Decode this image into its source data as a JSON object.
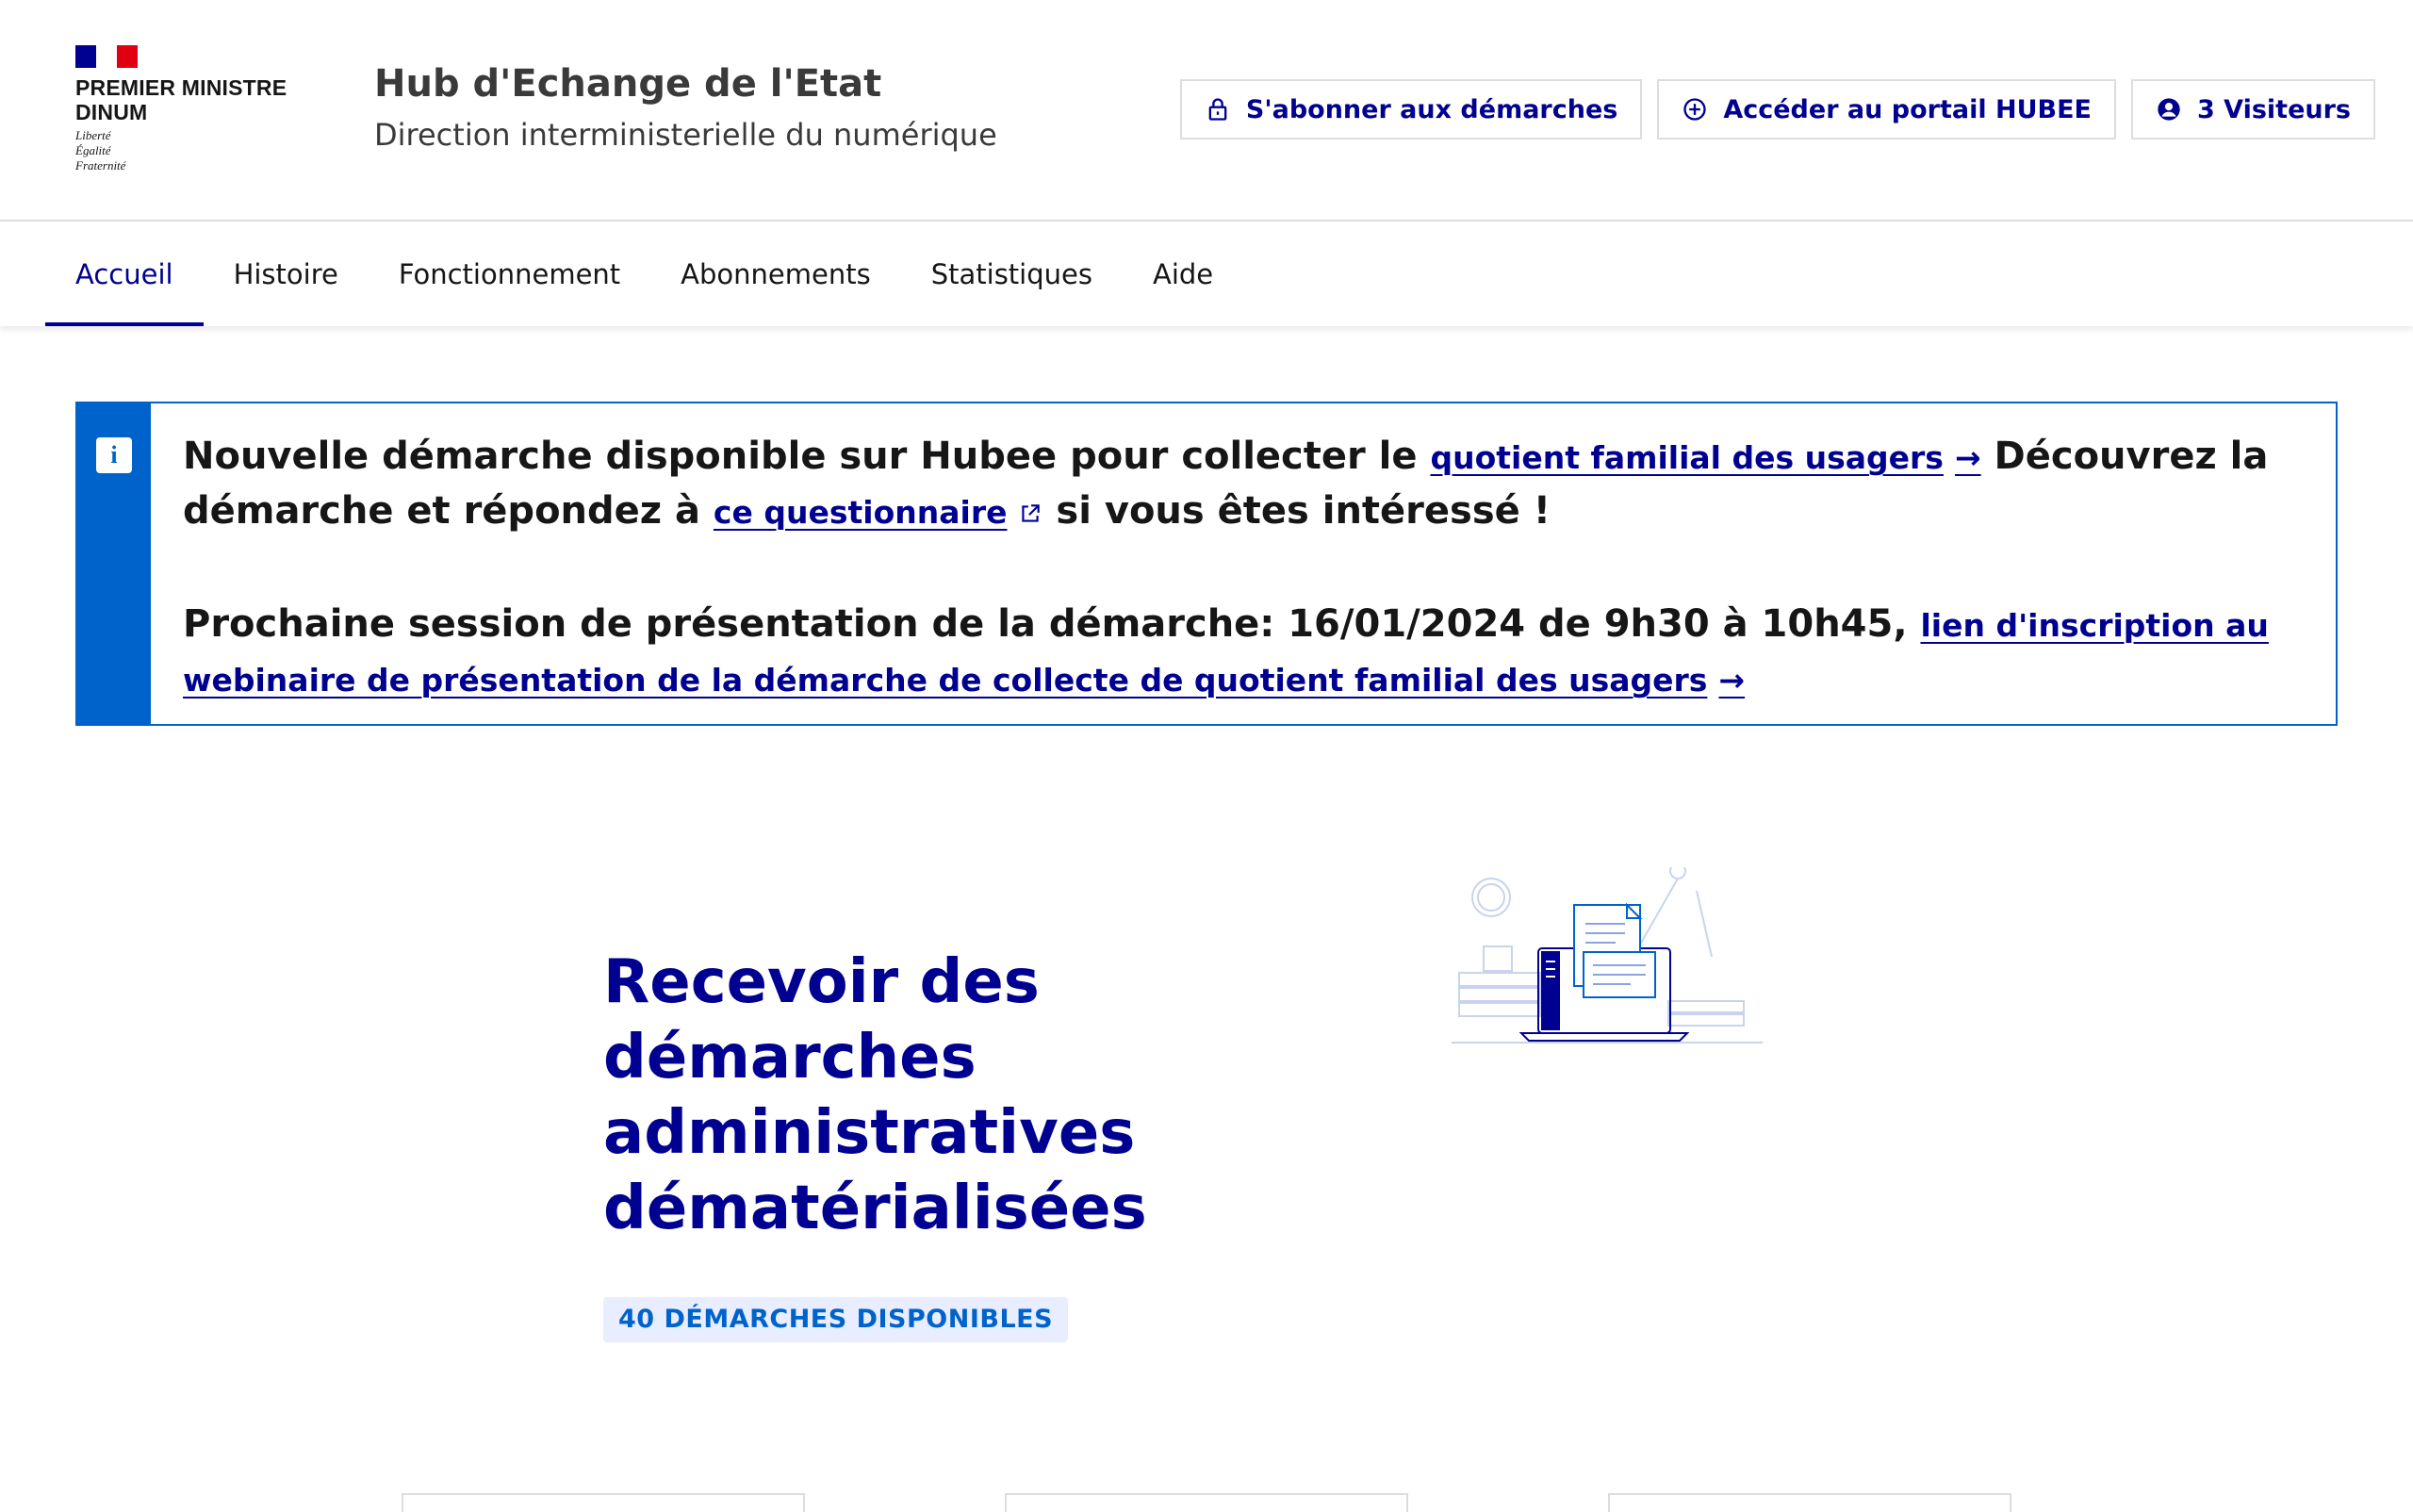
{
  "header": {
    "logo": {
      "title_line1": "PREMIER MINISTRE",
      "title_line2": "DINUM",
      "motto": [
        "Liberté",
        "Égalité",
        "Fraternité"
      ],
      "flag_colors": [
        "#000091",
        "#ffffff",
        "#e1000f"
      ]
    },
    "service_title": "Hub d'Echange de l'Etat",
    "service_tagline": "Direction interministerielle du numérique",
    "tools": [
      {
        "label": "S'abonner aux démarches",
        "icon": "lock-icon"
      },
      {
        "label": "Accéder au portail HUBEE",
        "icon": "add-circle-icon"
      },
      {
        "label": "3 Visiteurs",
        "icon": "user-icon"
      }
    ]
  },
  "nav": {
    "items": [
      "Accueil",
      "Histoire",
      "Fonctionnement",
      "Abonnements",
      "Statistiques",
      "Aide"
    ],
    "active": "Accueil"
  },
  "notice": {
    "icon": "info-icon",
    "p1_text1": "Nouvelle démarche disponible sur Hubee pour collecter le",
    "p1_link1": "quotient familial des usagers",
    "p1_text2": "Découvrez la démarche et répondez à",
    "p1_link2": "ce questionnaire",
    "p1_text3": "si vous êtes intéressé !",
    "p2_text": "Prochaine session de présentation de la démarche: 16/01/2024 de 9h30 à 10h45,",
    "p2_link": "lien d'inscription au webinaire de présentation de la démarche de collecte de quotient familial des usagers"
  },
  "hero": {
    "title": "Recevoir des démarches administratives dématérialisées",
    "badge": "40 DÉMARCHES DISPONIBLES",
    "illustration": "laptop-documents-illustration"
  },
  "colors": {
    "primary": "#000091",
    "info": "#0063cb",
    "badge_bg": "#e8edff",
    "border": "#dddddd"
  }
}
